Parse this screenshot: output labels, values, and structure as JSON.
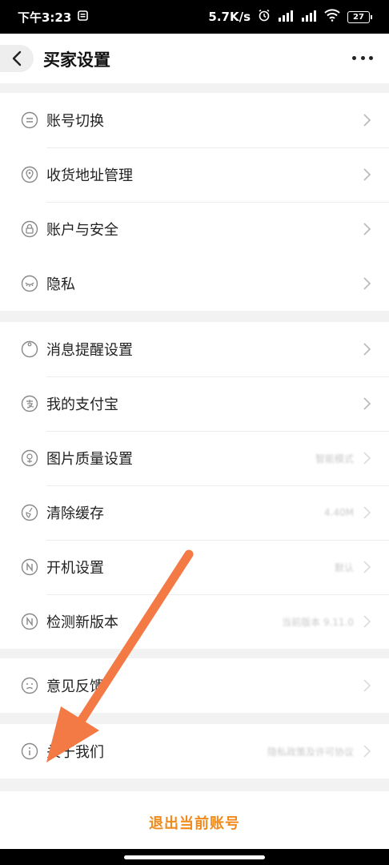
{
  "status_bar": {
    "time": "下午3:23",
    "net_speed": "5.7K/s",
    "battery": "27"
  },
  "header": {
    "title": "买家设置"
  },
  "groups": [
    {
      "items": [
        {
          "label": "账号切换",
          "icon": "switch-account-icon"
        },
        {
          "label": "收货地址管理",
          "icon": "location-pin-icon"
        },
        {
          "label": "账户与安全",
          "icon": "lock-icon"
        }
      ]
    },
    {
      "items": [
        {
          "label": "隐私",
          "icon": "eye-closed-icon"
        }
      ]
    },
    {
      "items": [
        {
          "label": "消息提醒设置",
          "icon": "bell-icon"
        },
        {
          "label": "我的支付宝",
          "icon": "alipay-icon"
        },
        {
          "label": "图片质量设置",
          "icon": "image-quality-icon",
          "value": "智能模式"
        },
        {
          "label": "清除缓存",
          "icon": "broom-icon",
          "value": "4.40M"
        },
        {
          "label": "开机设置",
          "icon": "n-circle-icon",
          "value": "默认"
        },
        {
          "label": "检测新版本",
          "icon": "n-circle-icon",
          "value": "当前版本 9.11.0"
        }
      ]
    },
    {
      "items": [
        {
          "label": "意见反馈",
          "icon": "frown-face-icon"
        }
      ]
    },
    {
      "items": [
        {
          "label": "关于我们",
          "icon": "info-icon",
          "value": "隐私政策及许可协议"
        }
      ]
    }
  ],
  "logout": {
    "label": "退出当前账号"
  },
  "colors": {
    "accent": "#f08a1c",
    "arrow": "#f47a45"
  }
}
